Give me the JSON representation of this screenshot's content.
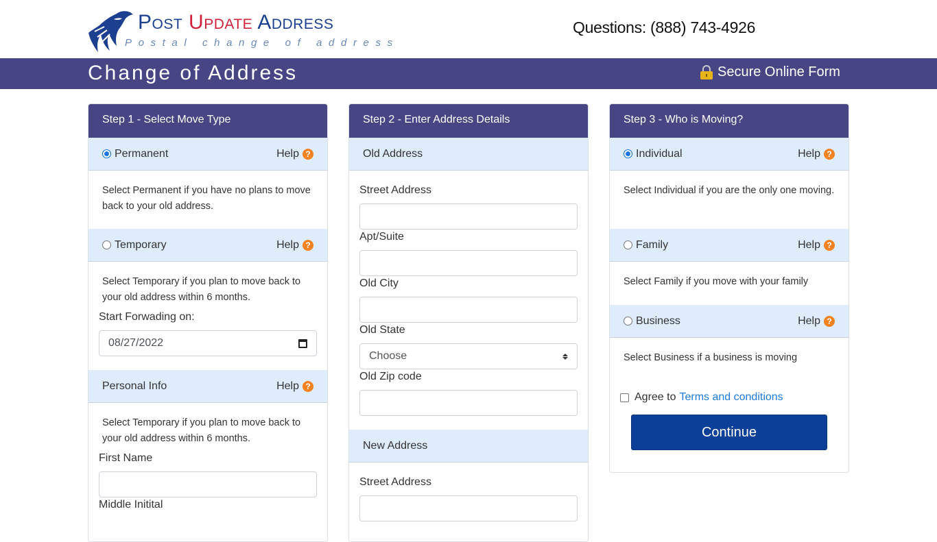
{
  "header": {
    "logo": {
      "word1": "Post",
      "word2": "Update",
      "word3": "Address",
      "tagline": "Postal change of address"
    },
    "questions": "Questions: (888) 743-4926"
  },
  "titlebar": {
    "title": "Change of Address",
    "secure_label": "Secure Online Form",
    "lock_icon": "lock-icon"
  },
  "colors": {
    "brand_purple": "#484584",
    "subheader_blue": "#deecfc",
    "help_orange": "#f58220",
    "button_blue": "#0c3f97",
    "link_blue": "#1a7ad9",
    "logo_blue": "#1d3f8f",
    "logo_red": "#d1213a"
  },
  "step1": {
    "header": "Step 1 - Select Move Type",
    "options": [
      {
        "label": "Permanent",
        "checked": true,
        "help": "Help",
        "description": "Select Permanent if you have no plans to move back to your old address."
      },
      {
        "label": "Temporary",
        "checked": false,
        "help": "Help",
        "description": "Select Temporary if you plan to move back to your old address within 6 months."
      }
    ],
    "start_forwarding_label": "Start Forwading on:",
    "start_forwarding_value": "08/27/2022",
    "personal_info": {
      "header": "Personal Info",
      "help": "Help",
      "description": "Select Temporary if you plan to move back to your old address within 6 months.",
      "first_name_label": "First Name",
      "first_name_value": "",
      "middle_initial_label": "Middle Initital"
    }
  },
  "step2": {
    "header": "Step 2 - Enter Address Details",
    "old_address": {
      "header": "Old Address",
      "street_label": "Street Address",
      "street_value": "",
      "apt_label": "Apt/Suite",
      "apt_value": "",
      "city_label": "Old City",
      "city_value": "",
      "state_label": "Old State",
      "state_selected": "Choose",
      "zip_label": "Old Zip code",
      "zip_value": ""
    },
    "new_address": {
      "header": "New Address",
      "street_label": "Street Address",
      "street_value": ""
    }
  },
  "step3": {
    "header": "Step 3 - Who is Moving?",
    "options": [
      {
        "label": "Individual",
        "checked": true,
        "help": "Help",
        "description": "Select Individual if you are the only one moving."
      },
      {
        "label": "Family",
        "checked": false,
        "help": "Help",
        "description": "Select Family if you move with your family"
      },
      {
        "label": "Business",
        "checked": false,
        "help": "Help",
        "description": "Select Business if a business is moving"
      }
    ],
    "agree_prefix": "Agree to",
    "terms_link": "Terms and conditions",
    "agree_checked": false,
    "continue_label": "Continue"
  }
}
